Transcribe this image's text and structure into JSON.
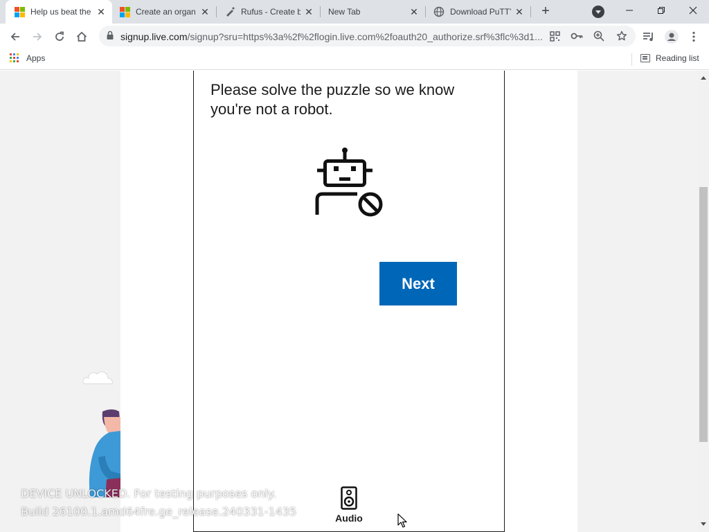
{
  "browser": {
    "tabs": [
      {
        "title": "Help us beat the",
        "icon": "microsoft-logo-icon",
        "active": true
      },
      {
        "title": "Create an organ",
        "icon": "microsoft-logo-icon",
        "active": false
      },
      {
        "title": "Rufus - Create b",
        "icon": "rufus-usb-icon",
        "active": false
      },
      {
        "title": "New Tab",
        "icon": "",
        "active": false
      },
      {
        "title": "Download PuTTY",
        "icon": "globe-icon",
        "active": false
      }
    ],
    "url_host": "signup.live.com",
    "url_rest": "/signup?sru=https%3a%2f%2flogin.live.com%2foauth20_authorize.srf%3flc%3d1...",
    "bookmarks": {
      "apps_label": "Apps",
      "reading_list_label": "Reading list"
    }
  },
  "page": {
    "puzzle_text": "Please solve the puzzle so we know you're not a robot.",
    "next_label": "Next",
    "audio_label": "Audio"
  },
  "watermark": {
    "line1": "DEVICE UNLOCKED. For testing purposes only.",
    "line2": "Build 26100.1.amd64fre.ge_release.240331-1435"
  },
  "colors": {
    "accent": "#0067b8",
    "tabstrip": "#dee1e6",
    "page_bg": "#f2f2f2"
  }
}
